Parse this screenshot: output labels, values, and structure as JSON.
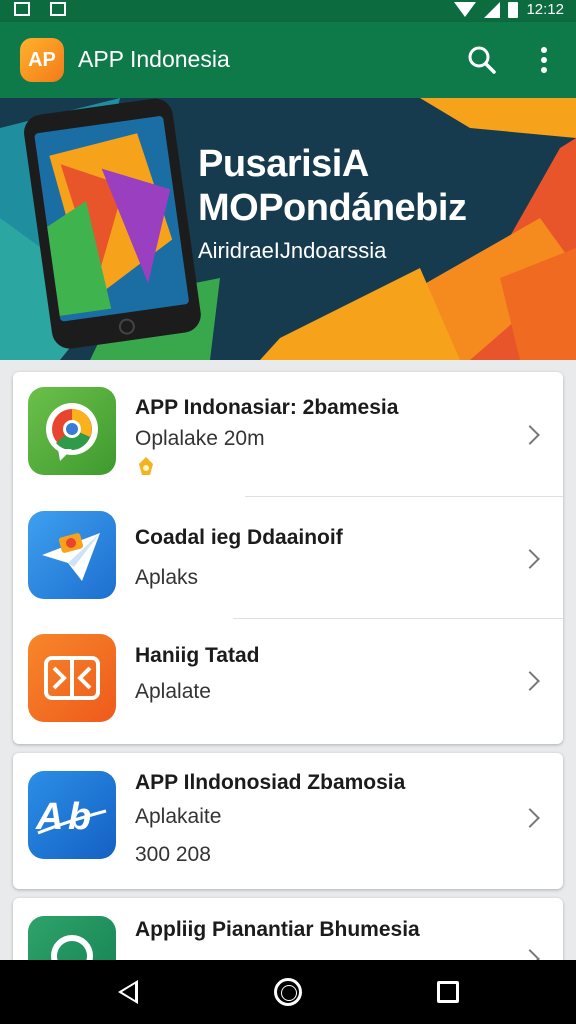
{
  "status_bar": {
    "time": "12:12",
    "left_icons": [
      "photo-icon",
      "gallery-icon"
    ],
    "right_icons": [
      "wifi-icon",
      "signal-icon",
      "battery-icon"
    ]
  },
  "app_bar": {
    "logo_text": "AP",
    "title": "APP Indonesia",
    "actions": [
      "search-icon",
      "more-vert-icon"
    ]
  },
  "banner": {
    "title_line1": "PusarisiA",
    "title_line2": "MOPondánebiz",
    "subtitle": "AiridraeIJndoarssia"
  },
  "apps": [
    {
      "name": "APP Indonasiar: 2bamesia",
      "sub": "Oplalake 20m",
      "extra": "",
      "icon": "chrome-like-icon",
      "badge": "coin-icon"
    },
    {
      "name": "Coadal ieg Ddaainoif",
      "sub": "Aplaks",
      "extra": "",
      "icon": "paper-plane-icon"
    },
    {
      "name": "Haniig Tatad",
      "sub": "Aplalate",
      "extra": "",
      "icon": "box-icon"
    },
    {
      "name": "APP Ilndonosiad Zbamosia",
      "sub": "Aplakaite",
      "extra": "300 208",
      "icon": "ab-logo-icon"
    },
    {
      "name": "Appliig Pianantiar Bhumesia",
      "sub": "",
      "extra": "",
      "icon": "green-circle-icon"
    }
  ],
  "colors": {
    "primary": "#0e7a4a",
    "status_bar": "#0c6b3f",
    "accent": "#f37a1a"
  },
  "nav_bar": [
    "back-icon",
    "home-icon",
    "recents-icon"
  ]
}
